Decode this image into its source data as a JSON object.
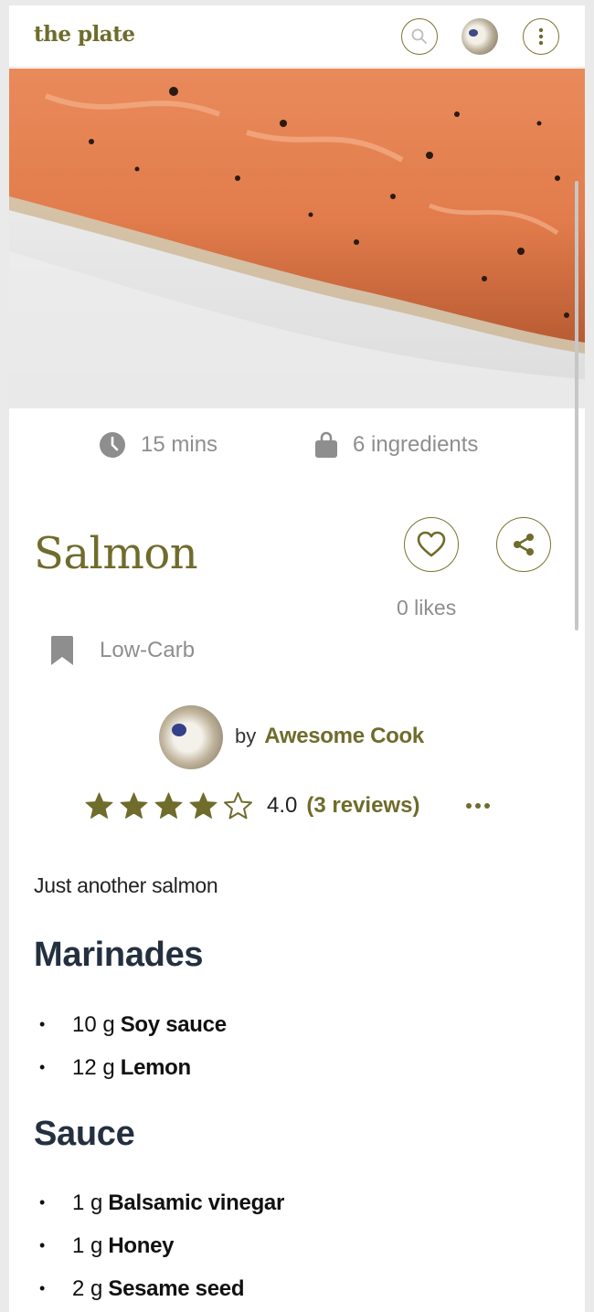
{
  "header": {
    "logo": "the plate",
    "search_icon": "search-icon",
    "menu_icon": "more-vertical-icon"
  },
  "recipe": {
    "title": "Salmon",
    "time": "15 mins",
    "ingredients_count": "6 ingredients",
    "likes": "0 likes",
    "tag": "Low-Carb",
    "author_prefix": "by",
    "author_name": "Awesome Cook",
    "rating_value": "4.0",
    "rating_reviews": "(3 reviews)",
    "rating_stars": 4,
    "rating_max": 5,
    "description": "Just another salmon"
  },
  "sections": [
    {
      "title": "Marinades",
      "items": [
        {
          "qty": "10 g",
          "name": "Soy sauce"
        },
        {
          "qty": "12 g",
          "name": "Lemon"
        }
      ]
    },
    {
      "title": "Sauce",
      "items": [
        {
          "qty": "1 g",
          "name": "Balsamic vinegar"
        },
        {
          "qty": "1 g",
          "name": "Honey"
        },
        {
          "qty": "2 g",
          "name": "Sesame seed"
        }
      ]
    }
  ],
  "colors": {
    "accent": "#6f6c2c",
    "muted": "#8e8e8e",
    "heading": "#243040"
  },
  "icons": {
    "time": "clock-icon",
    "ingredients": "bag-icon",
    "like": "heart-icon",
    "share": "share-icon",
    "tag": "bookmark-icon",
    "star_full": "star-filled-icon",
    "star_empty": "star-outline-icon",
    "more": "more-horizontal-icon"
  }
}
